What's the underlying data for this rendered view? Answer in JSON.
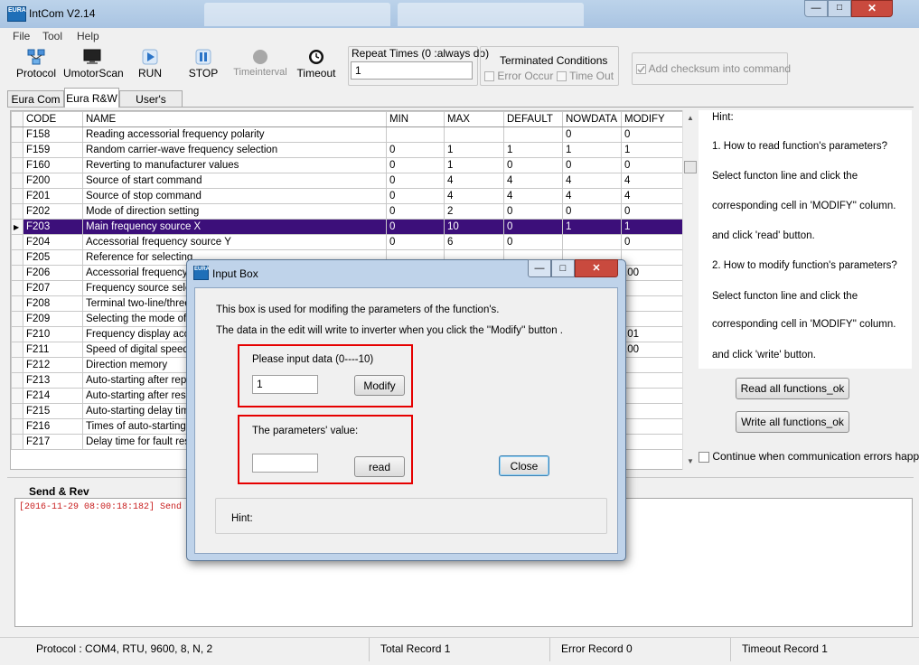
{
  "window": {
    "title": "IntCom V2.14",
    "logo_text": "EURA"
  },
  "menu": [
    "File",
    "Tool",
    "Help"
  ],
  "toolbar": {
    "protocol": "Protocol",
    "umotorscan": "UmotorScan",
    "run": "RUN",
    "stop": "STOP",
    "timeinterval": "Timeinterval",
    "timeout": "Timeout",
    "repeat_label": "Repeat Times (0 :always do)",
    "repeat_value": "1",
    "terminated_title": "Terminated Conditions",
    "error_occur": "Error Occur",
    "time_out": "Time Out",
    "checksum": "Add checksum into command",
    "checksum_checked": true
  },
  "tabs": [
    "Eura Com",
    "Eura R&W",
    "User's Define"
  ],
  "active_tab": 1,
  "grid": {
    "columns": [
      "CODE",
      "NAME",
      "MIN",
      "MAX",
      "DEFAULT",
      "NOWDATA",
      "MODIFY"
    ],
    "selected_row": 6,
    "rows": [
      [
        "F158",
        "Reading accessorial frequency polarity",
        "",
        "",
        "",
        "0",
        "0"
      ],
      [
        "F159",
        "Random carrier-wave frequency selection",
        "0",
        "1",
        "1",
        "1",
        "1"
      ],
      [
        "F160",
        "Reverting to manufacturer values",
        "0",
        "1",
        "0",
        "0",
        "0"
      ],
      [
        "F200",
        "Source of start command",
        "0",
        "4",
        "4",
        "4",
        "4"
      ],
      [
        "F201",
        "Source of stop command",
        "0",
        "4",
        "4",
        "4",
        "4"
      ],
      [
        "F202",
        "Mode of direction setting",
        "0",
        "2",
        "0",
        "0",
        "0"
      ],
      [
        "F203",
        "Main frequency source X",
        "0",
        "10",
        "0",
        "1",
        "1"
      ],
      [
        "F204",
        "Accessorial frequency source Y",
        "0",
        "6",
        "0",
        "",
        "0"
      ],
      [
        "F205",
        "Reference for selecting",
        "",
        "",
        "",
        "",
        ""
      ],
      [
        "F206",
        "Accessorial frequency Y",
        "",
        "",
        "",
        "",
        ".00"
      ],
      [
        "F207",
        "Frequency source selec",
        "",
        "",
        "",
        "",
        ""
      ],
      [
        "F208",
        "Terminal two-line/three-",
        "",
        "",
        "",
        "",
        ""
      ],
      [
        "F209",
        "Selecting the mode of s",
        "",
        "",
        "",
        "",
        ""
      ],
      [
        "F210",
        "Frequency display accu",
        "",
        "",
        "",
        "",
        ".01"
      ],
      [
        "F211",
        "Speed of digital speed c",
        "",
        "",
        "",
        "",
        ".00"
      ],
      [
        "F212",
        "Direction memory",
        "",
        "",
        "",
        "",
        ""
      ],
      [
        "F213",
        "Auto-starting after repov",
        "",
        "",
        "",
        "",
        ""
      ],
      [
        "F214",
        "Auto-starting  after reset",
        "",
        "",
        "",
        "",
        ""
      ],
      [
        "F215",
        "Auto-starting delay time",
        "",
        "",
        "",
        "",
        ""
      ],
      [
        "F216",
        "Times of auto-starting in",
        "",
        "",
        "",
        "",
        ""
      ],
      [
        "F217",
        "Delay time for fault reset",
        "",
        "",
        "",
        "",
        ""
      ]
    ]
  },
  "hints": {
    "title": "Hint:",
    "lines": [
      "1. How to read function's parameters?",
      "Select functon line and click the",
      "corresponding cell in  'MODIFY'' column.",
      "and click 'read' button.",
      "2. How to modify function's parameters?",
      "Select functon line and click the",
      "corresponding cell in  'MODIFY'' column.",
      "and click 'write' button."
    ],
    "read_all": "Read all functions_ok",
    "write_all": "Write all functions_ok",
    "continue_label": "Continue when communication errors happen"
  },
  "sendrev": {
    "title": "Send & Rev",
    "log_line": "[2016-11-29 08:00:18:182] Send"
  },
  "status": {
    "protocol": "Protocol :  COM4, RTU, 9600, 8, N, 2",
    "total": "Total Record   1",
    "error": "Error Record   0",
    "timeout": "Timeout Record   1"
  },
  "dialog": {
    "title": "Input Box",
    "desc1": "This box is used for modifing the parameters of the function's.",
    "desc2": "The data in the edit will write to inverter when you click the ''Modify'' button .",
    "input_label": "Please input data (0----10)",
    "input_value": "1",
    "modify": "Modify",
    "param_label": "The parameters'  value:",
    "param_value": "",
    "read": "read",
    "close": "Close",
    "hint": "Hint:"
  }
}
